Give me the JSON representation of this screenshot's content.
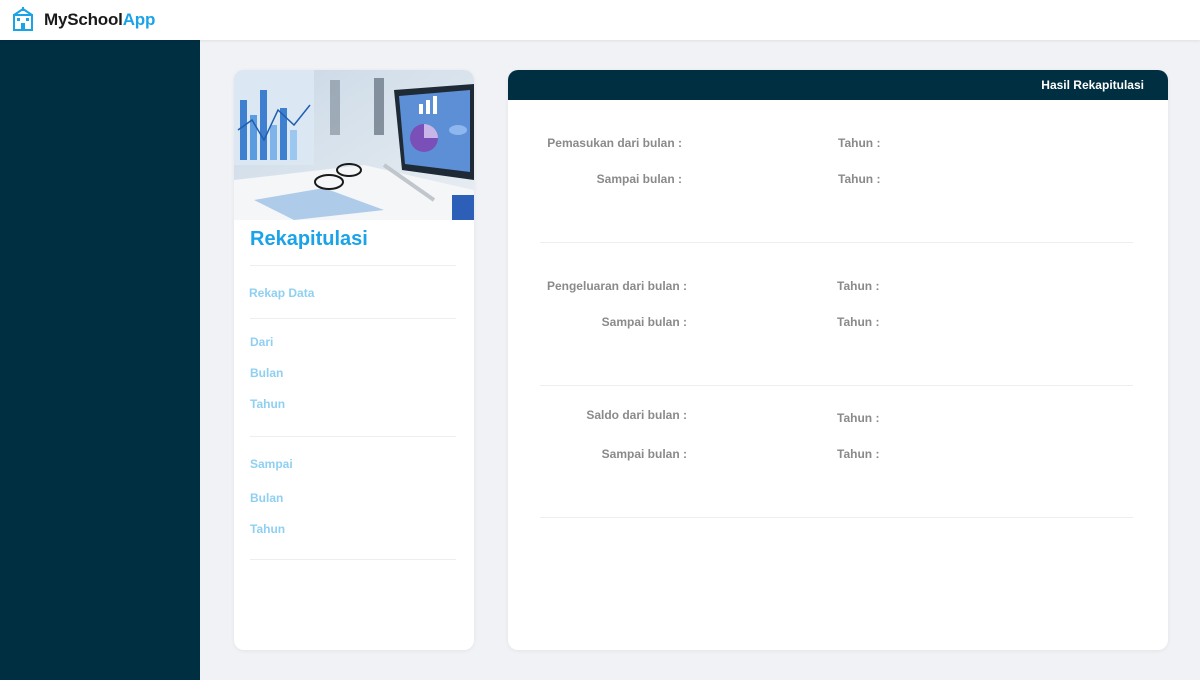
{
  "app": {
    "brand_main": "MySchool",
    "brand_accent": "App",
    "icon": "school-building-icon",
    "accent_color": "#1aa3e8",
    "sidebar_color": "#002f42"
  },
  "left_card": {
    "image": "business-charts-photo",
    "title": "Rekapitulasi",
    "section_rekap": "Rekap Data",
    "dari_label": "Dari",
    "dari_bulan": "Bulan",
    "dari_tahun": "Tahun",
    "sampai_label": "Sampai",
    "sampai_bulan": "Bulan",
    "sampai_tahun": "Tahun"
  },
  "right_card": {
    "header": "Hasil Rekapitulasi",
    "pemasukan": {
      "from_label": "Pemasukan dari bulan :",
      "from_tahun": "Tahun :",
      "to_label": "Sampai bulan :",
      "to_tahun": "Tahun :"
    },
    "pengeluaran": {
      "from_label": "Pengeluaran dari bulan :",
      "from_tahun": "Tahun :",
      "to_label": "Sampai bulan :",
      "to_tahun": "Tahun :"
    },
    "saldo": {
      "from_label": "Saldo dari bulan :",
      "from_tahun": "Tahun :",
      "to_label": "Sampai bulan :",
      "to_tahun": "Tahun :"
    }
  }
}
